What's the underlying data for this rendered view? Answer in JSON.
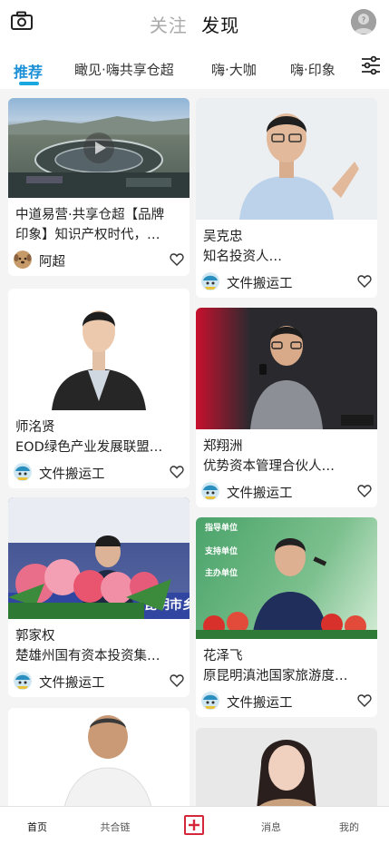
{
  "header": {
    "follow_label": "关注",
    "discover_label": "发现",
    "icons": {
      "left": "camera-icon",
      "right": "user-avatar-icon"
    }
  },
  "categories": [
    {
      "label": "推荐",
      "active": true
    },
    {
      "label": "瞰见·嗨共享仓超"
    },
    {
      "label": "嗨·大咖"
    },
    {
      "label": "嗨·印象"
    }
  ],
  "filter_icon": "sliders-icon",
  "feed": {
    "left": [
      {
        "line1": "中道易营·共享仓超【品牌",
        "line2": "印象】知识产权时代，…",
        "author": "阿超",
        "avatar": "dog-avatar",
        "media": "video"
      },
      {
        "line1": "师洺贤",
        "line2": "EOD绿色产业发展联盟…",
        "author": "文件搬运工",
        "avatar": "mascot-avatar"
      },
      {
        "line1": "郭家权",
        "line2": "楚雄州国有资本投资集…",
        "author": "文件搬运工",
        "avatar": "mascot-avatar"
      },
      {
        "line1": "",
        "line2": "",
        "author": "",
        "avatar": ""
      }
    ],
    "right": [
      {
        "line1": "吴克忠",
        "line2": "知名投资人…",
        "author": "文件搬运工",
        "avatar": "mascot-avatar"
      },
      {
        "line1": "郑翔洲",
        "line2": "优势资本管理合伙人…",
        "author": "文件搬运工",
        "avatar": "mascot-avatar"
      },
      {
        "line1": "花泽飞",
        "line2": "原昆明滇池国家旅游度…",
        "author": "文件搬运工",
        "avatar": "mascot-avatar"
      },
      {
        "line1": "",
        "line2": "",
        "author": "",
        "avatar": ""
      }
    ]
  },
  "image_texts": {
    "stage_banner": "昆明市乡",
    "board_title_1": "指导单位",
    "board_title_2": "支持单位",
    "board_title_3": "主办单位"
  },
  "bottom_nav": [
    {
      "label": "首页",
      "active": true
    },
    {
      "label": "共合链"
    },
    {
      "label": "",
      "icon": "plus-square-icon"
    },
    {
      "label": "消息"
    },
    {
      "label": "我的"
    }
  ],
  "colors": {
    "accent": "#1aa7e0",
    "active_tab": "#1a8fd6",
    "plus": "#d6263a"
  }
}
